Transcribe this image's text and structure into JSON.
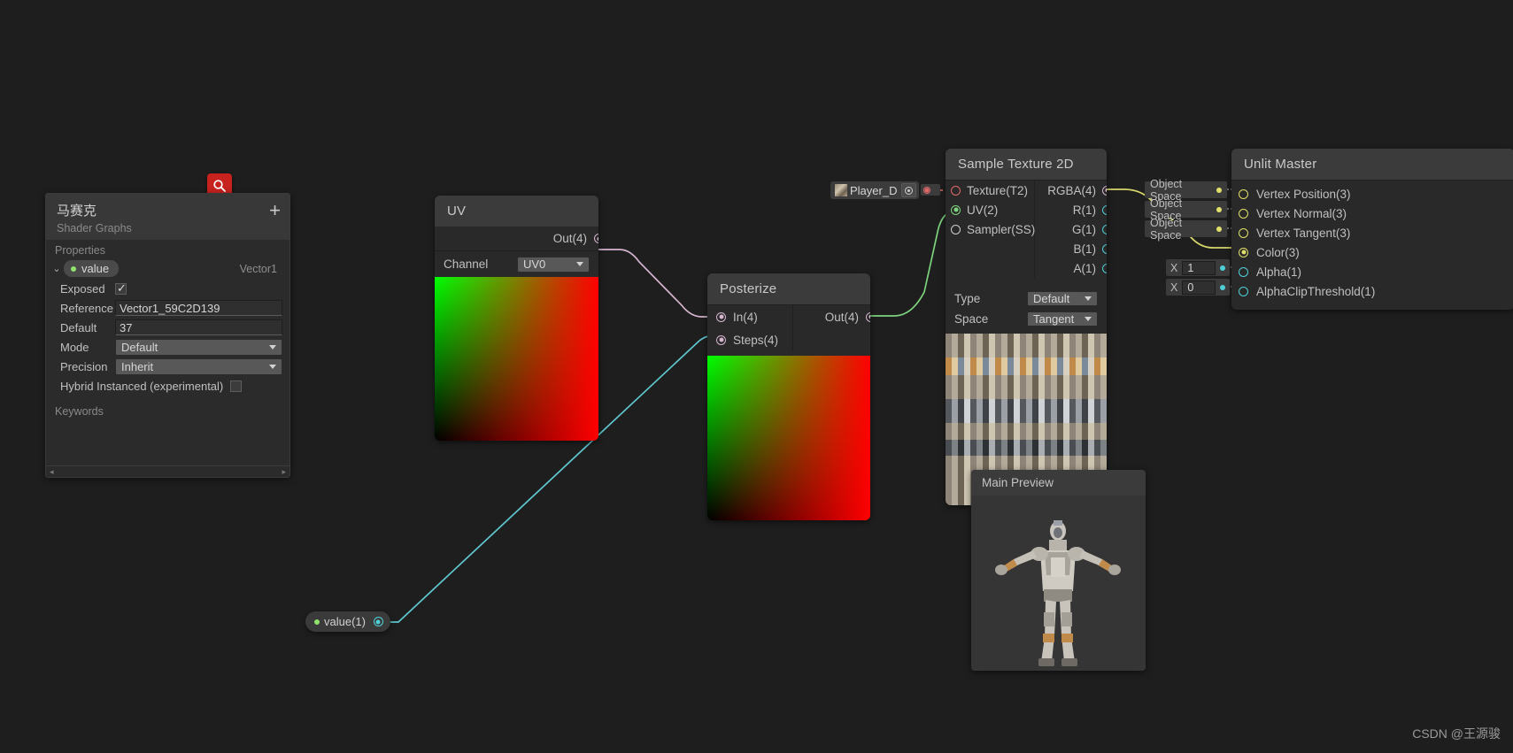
{
  "app": {
    "watermark": "CSDN @王源骏"
  },
  "blackboard": {
    "title": "马赛克",
    "subtitle": "Shader Graphs",
    "add_label": "+",
    "sections": {
      "properties": "Properties",
      "keywords": "Keywords"
    },
    "property": {
      "chevron": "⌄",
      "name": "value",
      "type": "Vector1",
      "rows": [
        {
          "label": "Exposed",
          "kind": "checkbox",
          "value": "checked"
        },
        {
          "label": "Reference",
          "kind": "text",
          "value": "Vector1_59C2D139"
        },
        {
          "label": "Default",
          "kind": "text",
          "value": "37"
        },
        {
          "label": "Mode",
          "kind": "dropdown",
          "value": "Default"
        },
        {
          "label": "Precision",
          "kind": "dropdown",
          "value": "Inherit"
        },
        {
          "label": "Hybrid Instanced (experimental)",
          "kind": "checkbox",
          "value": "unchecked"
        }
      ]
    },
    "scroll_left": "◂",
    "scroll_right": "▸"
  },
  "search_button": {
    "icon": "search-icon",
    "color": "#c8221f"
  },
  "nodes": {
    "uv": {
      "title": "UV",
      "out_port": "Out(4)",
      "channel_label": "Channel",
      "channel_value": "UV0"
    },
    "posterize": {
      "title": "Posterize",
      "in_ports": [
        "In(4)",
        "Steps(4)"
      ],
      "out_port": "Out(4)"
    },
    "sample_texture_2d": {
      "title": "Sample Texture 2D",
      "in_ports": [
        "Texture(T2)",
        "UV(2)",
        "Sampler(SS)"
      ],
      "out_ports": [
        "RGBA(4)",
        "R(1)",
        "G(1)",
        "B(1)",
        "A(1)"
      ],
      "type_label": "Type",
      "type_value": "Default",
      "space_label": "Space",
      "space_value": "Tangent"
    },
    "unlit_master": {
      "title": "Unlit Master",
      "slots": [
        {
          "label": "Vertex Position(3)",
          "side": "Object Space",
          "port": "yellow-hollow"
        },
        {
          "label": "Vertex Normal(3)",
          "side": "Object Space",
          "port": "yellow-hollow"
        },
        {
          "label": "Vertex Tangent(3)",
          "side": "Object Space",
          "port": "yellow-hollow"
        },
        {
          "label": "Color(3)",
          "side": "",
          "port": "yellow-filled"
        },
        {
          "label": "Alpha(1)",
          "side": "X",
          "value": "1",
          "port": "cyan-hollow"
        },
        {
          "label": "AlphaClipThreshold(1)",
          "side": "X",
          "value": "0",
          "port": "cyan-hollow"
        }
      ]
    },
    "value_property": {
      "label": "value(1)"
    },
    "texture_asset": {
      "name": "Player_D",
      "picker": "object-picker-icon"
    }
  },
  "main_preview": {
    "title": "Main Preview"
  },
  "colors": {
    "node_body": "#292929",
    "node_header": "#3b3b3b",
    "wire_pink": "#d6b5cf",
    "wire_green": "#7ed47e",
    "wire_cyan": "#4fd0d8",
    "wire_yellow": "#d8d86a",
    "accent_red": "#c8221f",
    "canvas": "#1e1e1e"
  }
}
